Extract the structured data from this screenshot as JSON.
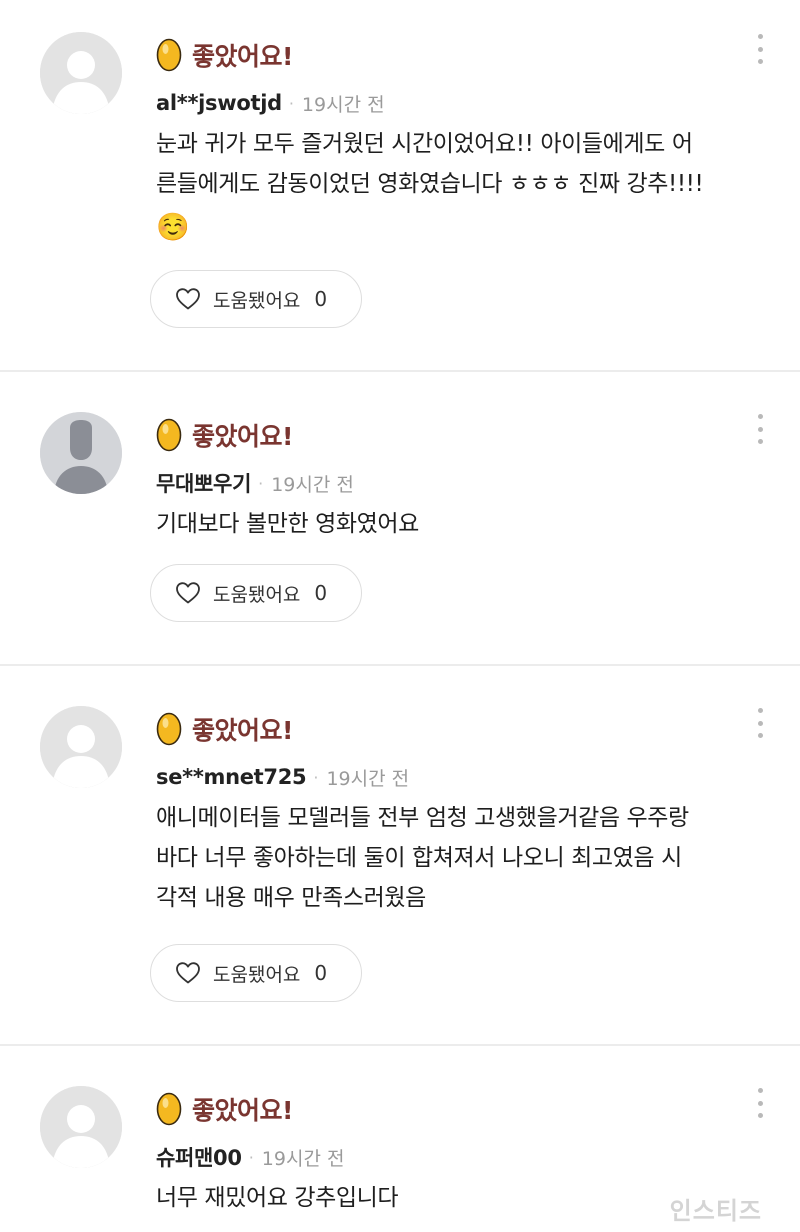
{
  "comments": [
    {
      "rating_label": "좋았어요!",
      "username": "al**jswotjd",
      "time": "19시간 전",
      "lines": [
        "눈과 귀가 모두 즐거웠던 시간이었어요!! 아이들에게도 어",
        "른들에게도 감동이었던 영화였습니다 ㅎㅎㅎ 진짜 강추!!!!"
      ],
      "emoji": "☺️",
      "helpful_label": "도움됐어요",
      "helpful_count": "0"
    },
    {
      "rating_label": "좋았어요!",
      "username": "무대뽀우기",
      "time": "19시간 전",
      "lines": [
        "기대보다 볼만한 영화였어요"
      ],
      "helpful_label": "도움됐어요",
      "helpful_count": "0"
    },
    {
      "rating_label": "좋았어요!",
      "username": "se**mnet725",
      "time": "19시간 전",
      "lines": [
        "애니메이터들 모델러들 전부 엄청 고생했을거같음 우주랑",
        "바다 너무 좋아하는데 둘이 합쳐져서 나오니 최고였음 시",
        "각적 내용 매우 만족스러웠음"
      ],
      "helpful_label": "도움됐어요",
      "helpful_count": "0"
    },
    {
      "rating_label": "좋았어요!",
      "username": "슈퍼맨00",
      "time": "19시간 전",
      "lines": [
        "너무 재밌어요 강추입니다"
      ]
    }
  ],
  "watermark": "인스티즈",
  "colors": {
    "rating": "#7a3530",
    "egg": "#f2b51c",
    "divider": "#ececec",
    "meta": "#9a9a9a"
  }
}
